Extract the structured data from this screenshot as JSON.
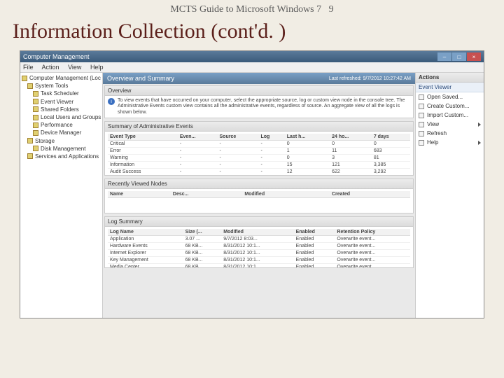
{
  "slide": {
    "header": "MCTS Guide to Microsoft Windows 7",
    "page_num": "9",
    "title": "Information Collection (cont'd. )"
  },
  "window": {
    "title": "Computer Management",
    "menu": [
      "File",
      "Action",
      "View",
      "Help"
    ]
  },
  "tree": {
    "root": "Computer Management (Local)",
    "group1": "System Tools",
    "items1": [
      "Task Scheduler",
      "Event Viewer",
      "Shared Folders",
      "Local Users and Groups",
      "Performance",
      "Device Manager"
    ],
    "group2": "Storage",
    "items2": [
      "Disk Management"
    ],
    "group3": "Services and Applications"
  },
  "center": {
    "panel_title": "Overview and Summary",
    "refreshed": "Last refreshed: 9/7/2012 10:27:42 AM",
    "overview": {
      "title": "Overview",
      "text": "To view events that have occurred on your computer, select the appropriate source, log or custom view node in the console tree. The Administrative Events custom view contains all the administrative events, regardless of source. An aggregate view of all the logs is shown below."
    },
    "summary_admin": {
      "title": "Summary of Administrative Events",
      "cols": [
        "Event Type",
        "Even...",
        "Source",
        "Log",
        "Last h...",
        "24 ho...",
        "7 days"
      ],
      "rows": [
        [
          "Critical",
          "-",
          "-",
          "-",
          "0",
          "0",
          "0"
        ],
        [
          "Error",
          "-",
          "-",
          "-",
          "1",
          "11",
          "683"
        ],
        [
          "Warning",
          "-",
          "-",
          "-",
          "0",
          "3",
          "81"
        ],
        [
          "Information",
          "-",
          "-",
          "-",
          "15",
          "121",
          "3,385"
        ],
        [
          "Audit Success",
          "-",
          "-",
          "-",
          "12",
          "622",
          "3,292"
        ]
      ]
    },
    "recent": {
      "title": "Recently Viewed Nodes",
      "cols": [
        "Name",
        "Desc...",
        "Modified",
        "Created"
      ]
    },
    "log_summary": {
      "title": "Log Summary",
      "cols": [
        "Log Name",
        "Size (...",
        "Modified",
        "Enabled",
        "Retention Policy"
      ],
      "rows": [
        [
          "Application",
          "3.07 ...",
          "9/7/2012 8:03...",
          "Enabled",
          "Overwrite event..."
        ],
        [
          "Hardware Events",
          "68 KB...",
          "8/31/2012 10:1...",
          "Enabled",
          "Overwrite event..."
        ],
        [
          "Internet Explorer",
          "68 KB...",
          "8/31/2012 10:1...",
          "Enabled",
          "Overwrite event..."
        ],
        [
          "Key Management",
          "68 KB...",
          "8/31/2012 10:1...",
          "Enabled",
          "Overwrite event..."
        ],
        [
          "Media Center",
          "68 KB...",
          "8/31/2012 10:1...",
          "Enabled",
          "Overwrite event..."
        ]
      ]
    }
  },
  "actions": {
    "title": "Actions",
    "section": "Event Viewer",
    "items": [
      {
        "label": "Open Saved...",
        "arrow": false
      },
      {
        "label": "Create Custom...",
        "arrow": false
      },
      {
        "label": "Import Custom...",
        "arrow": false
      },
      {
        "label": "View",
        "arrow": true
      },
      {
        "label": "Refresh",
        "arrow": false
      },
      {
        "label": "Help",
        "arrow": true
      }
    ]
  }
}
